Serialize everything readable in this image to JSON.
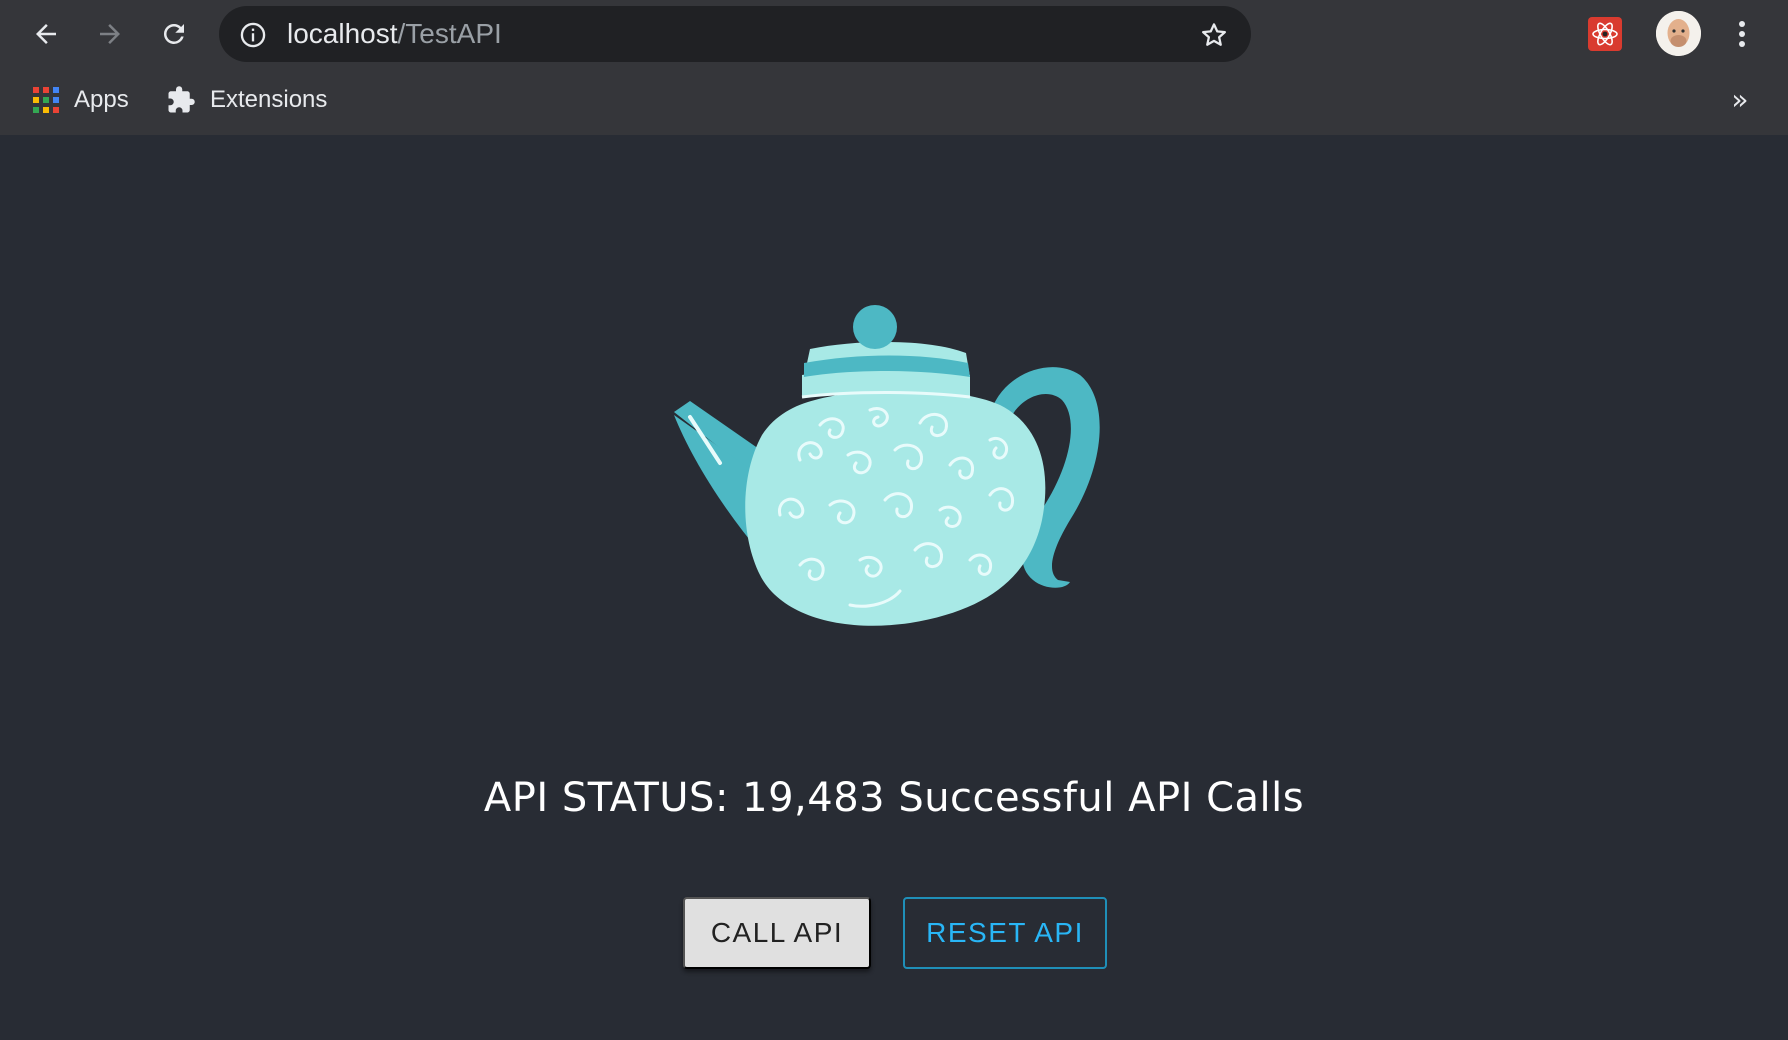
{
  "browser": {
    "url_host": "localhost",
    "url_path": "/TestAPI",
    "bookmarks": [
      {
        "label": "Apps",
        "icon": "apps-grid-icon"
      },
      {
        "label": "Extensions",
        "icon": "puzzle-icon"
      }
    ],
    "overflow_label": "»"
  },
  "main": {
    "status_text": "API STATUS: 19,483 Successful API Calls",
    "call_button_label": "CALL API",
    "reset_button_label": "RESET API"
  },
  "colors": {
    "page_background": "#282c34",
    "browser_chrome": "#35363a",
    "teapot_body": "#a8e9e6",
    "teapot_accent": "#4db8c4",
    "reset_accent": "#29b6f6"
  }
}
